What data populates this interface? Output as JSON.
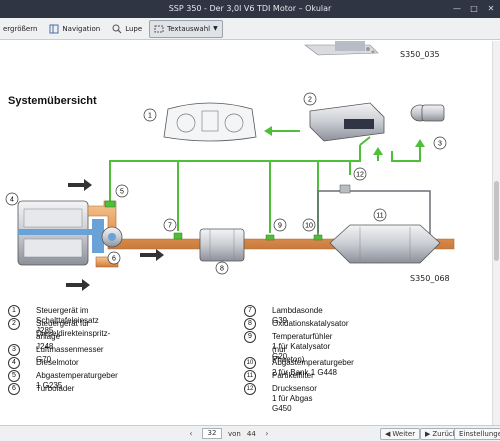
{
  "window": {
    "title": "SSP 350 - Der 3,0l V6 TDI Motor – Okular",
    "controls": [
      "minimize-icon",
      "maximize-icon",
      "close-icon"
    ]
  },
  "toolbar": {
    "zoom_label": "ergrößern",
    "navigation_label": "Navigation",
    "lupe_label": "Lupe",
    "textauswahl_label": "Textauswahl"
  },
  "document": {
    "top_ref": "S350_035",
    "heading": "Systemübersicht",
    "figure_ref": "S350_068",
    "components": [
      {
        "num": "1",
        "label": "Steuergerät im Schalttafeleinsatz J285"
      },
      {
        "num": "2",
        "label": "Steuergerät für Dieseldirekteinspritz-"
      },
      {
        "num": "",
        "label": "anlage J248"
      },
      {
        "num": "3",
        "label": "Luftmassenmesser G70"
      },
      {
        "num": "4",
        "label": "Dieselmotor"
      },
      {
        "num": "5",
        "label": "Abgastemperaturgeber 1  G235"
      },
      {
        "num": "6",
        "label": "Turbolader"
      },
      {
        "num": "7",
        "label": "Lambdasonde G39"
      },
      {
        "num": "8",
        "label": "Oxidationskatalysator"
      },
      {
        "num": "9",
        "label": "Temperaturfühler 1 für Katalysator G20"
      },
      {
        "num": "",
        "label": "(nur Phaeton)"
      },
      {
        "num": "10",
        "label": "Abgastemperaturgeber 2 für Bank 1  G448"
      },
      {
        "num": "11",
        "label": "Partikelfilter"
      },
      {
        "num": "12",
        "label": "Drucksensor 1 für Abgas G450"
      }
    ],
    "diagram_numbers": [
      "1",
      "2",
      "3",
      "4",
      "5",
      "6",
      "7",
      "8",
      "9",
      "10",
      "11",
      "12"
    ],
    "colors": {
      "signal": "#4fbf3a",
      "exhaust": "#e8a060",
      "metal": "#c9ccd2"
    }
  },
  "statusbar": {
    "page_current": "32",
    "page_of": "von",
    "page_total": "44",
    "back_label": "Weiter",
    "forward_label": "Zurück",
    "settings_label": "Einstellungen"
  }
}
